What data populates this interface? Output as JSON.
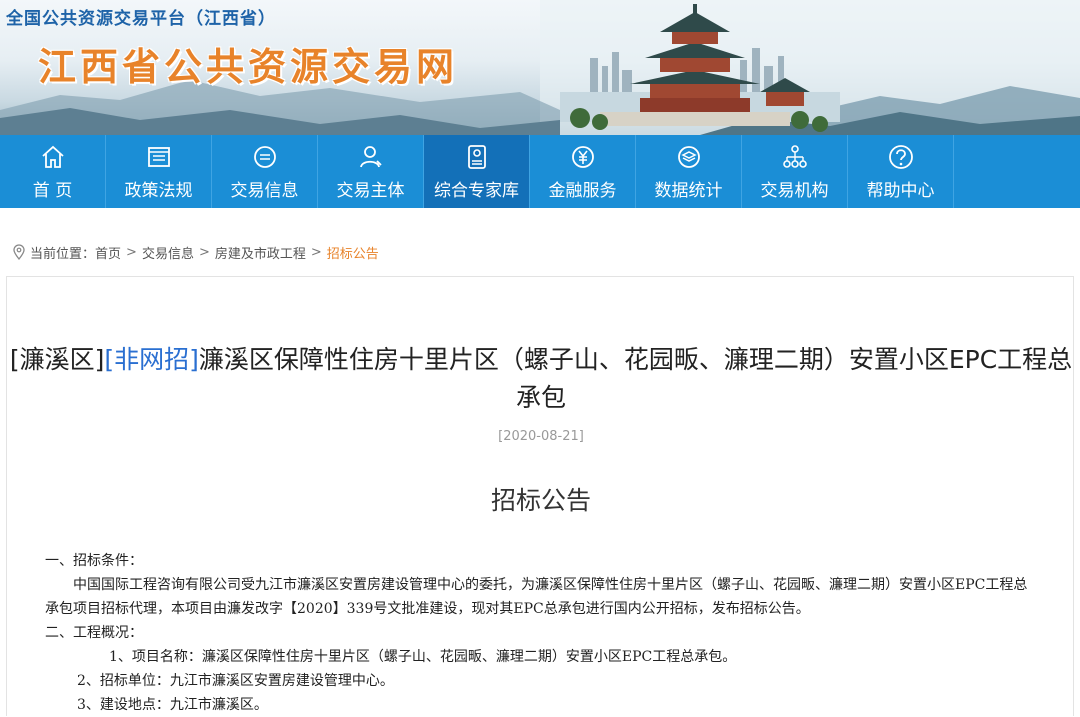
{
  "banner": {
    "platform_name": "全国公共资源交易平台（江西省）",
    "site_title": "江西省公共资源交易网"
  },
  "nav": {
    "items": [
      {
        "label": "首 页",
        "icon": "home-icon"
      },
      {
        "label": "政策法规",
        "icon": "document-icon"
      },
      {
        "label": "交易信息",
        "icon": "message-icon"
      },
      {
        "label": "交易主体",
        "icon": "user-icon"
      },
      {
        "label": "综合专家库",
        "icon": "id-card-icon"
      },
      {
        "label": "金融服务",
        "icon": "yuan-icon"
      },
      {
        "label": "数据统计",
        "icon": "layers-icon"
      },
      {
        "label": "交易机构",
        "icon": "org-chart-icon"
      },
      {
        "label": "帮助中心",
        "icon": "help-icon"
      }
    ],
    "active_index": 4,
    "colors": {
      "bar": "#1b8ed6",
      "active": "#1370b8"
    }
  },
  "breadcrumb": {
    "prefix": "当前位置：",
    "items": [
      "首页",
      "交易信息",
      "房建及市政工程"
    ],
    "current": "招标公告",
    "separator": ">"
  },
  "article": {
    "title_tag1": "[濂溪区]",
    "title_tag2": "[非网招]",
    "title_text": "濂溪区保障性住房十里片区（螺子山、花园畈、濂理二期）安置小区EPC工程总承包",
    "date": "[2020-08-21]",
    "doc_title": "招标公告",
    "paragraphs": [
      "一、招标条件：",
      "中国国际工程咨询有限公司受九江市濂溪区安置房建设管理中心的委托，为濂溪区保障性住房十里片区（螺子山、花园畈、濂理二期）安置小区EPC工程总承包项目招标代理，本项目由濂发改字【2020】339号文批准建设，现对其EPC总承包进行国内公开招标，发布招标公告。",
      "二、工程概况：",
      "1、项目名称：濂溪区保障性住房十里片区（螺子山、花园畈、濂理二期）安置小区EPC工程总承包。",
      "2、招标单位：九江市濂溪区安置房建设管理中心。",
      "3、建设地点：九江市濂溪区。"
    ]
  },
  "colors": {
    "accent_orange": "#e8832a",
    "link_blue": "#2a6fd1"
  }
}
